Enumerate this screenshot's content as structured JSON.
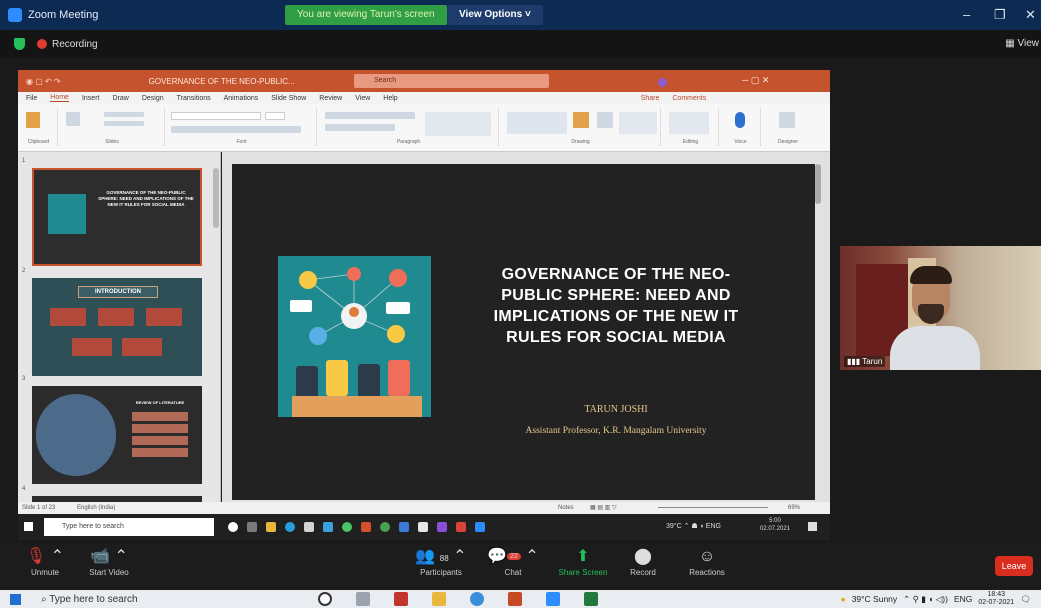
{
  "zoom": {
    "title": "Zoom Meeting",
    "viewing_banner": "You are viewing Tarun's screen",
    "view_options": "View Options ˅",
    "recording": "Recording",
    "view_button": "View",
    "accent": "#2d8cff",
    "banner_color": "#2f9e44"
  },
  "ppt": {
    "window_title": "GOVERNANCE OF THE NEO-PUBLIC...",
    "search": "Search",
    "tabs": [
      "File",
      "Home",
      "Insert",
      "Draw",
      "Design",
      "Transitions",
      "Animations",
      "Slide Show",
      "Review",
      "View",
      "Help"
    ],
    "share": "Share",
    "comments": "Comments",
    "ribbon_groups": [
      "Clipboard",
      "Slides",
      "Font",
      "Paragraph",
      "Drawing",
      "Editing",
      "Voice",
      "Designer"
    ],
    "status_left": "Slide 1 of 23",
    "status_lang": "English (India)",
    "status_notes": "Notes",
    "zoom_level": "69%"
  },
  "thumbnails": [
    {
      "num": "1",
      "title": "GOVERNANCE OF THE NEO-PUBLIC SPHERE: NEED AND IMPLICATIONS OF THE NEW IT RULES FOR SOCIAL MEDIA"
    },
    {
      "num": "2",
      "title": "INTRODUCTION"
    },
    {
      "num": "3",
      "title": "REVIEW OF LITERATURE"
    },
    {
      "num": "4",
      "title": ""
    }
  ],
  "slide": {
    "title": "GOVERNANCE OF THE NEO-PUBLIC SPHERE: NEED AND IMPLICATIONS OF THE NEW IT RULES FOR SOCIAL MEDIA",
    "author": "TARUN JOSHI",
    "role": "Assistant Professor, K.R. Mangalam University"
  },
  "remote_taskbar": {
    "search": "Type here to search",
    "weather": "39°C",
    "time": "5:00",
    "date": "02.07.2021"
  },
  "video": {
    "name": "Tarun"
  },
  "controls": {
    "unmute": "Unmute",
    "start_video": "Start Video",
    "participants": "Participants",
    "participants_count": "88",
    "chat": "Chat",
    "chat_badge": "22",
    "share_screen": "Share Screen",
    "record": "Record",
    "reactions": "Reactions",
    "leave": "Leave"
  },
  "local_taskbar": {
    "search": "Type here to search",
    "weather": "39°C Sunny",
    "lang": "ENG",
    "time": "18:43",
    "date": "02-07-2021"
  }
}
